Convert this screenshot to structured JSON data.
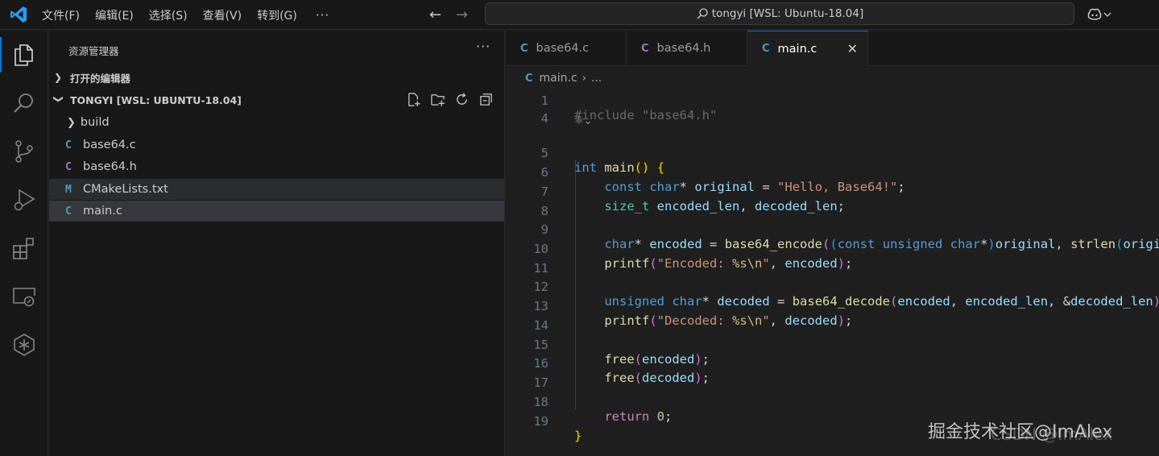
{
  "window": {
    "menu": [
      "文件(F)",
      "编辑(E)",
      "选择(S)",
      "查看(V)",
      "转到(G)"
    ],
    "menu_more": "···",
    "search_text": "tongyi [WSL: Ubuntu-18.04]"
  },
  "activity_bar": [
    "explorer-icon",
    "search-icon",
    "source-control-icon",
    "run-debug-icon",
    "extensions-icon",
    "remote-explorer-icon",
    "tongyi-icon"
  ],
  "sidebar": {
    "title": "资源管理器",
    "more": "···",
    "open_editors": "打开的编辑器",
    "workspace": "TONGYI [WSL: UBUNTU-18.04]",
    "tree": [
      {
        "name": "build",
        "kind": "folder"
      },
      {
        "name": "base64.c",
        "kind": "c",
        "icon": "C"
      },
      {
        "name": "base64.h",
        "kind": "h",
        "icon": "C"
      },
      {
        "name": "CMakeLists.txt",
        "kind": "cmake",
        "icon": "M"
      },
      {
        "name": "main.c",
        "kind": "c",
        "icon": "C"
      }
    ]
  },
  "editor": {
    "tabs": [
      {
        "label": "base64.c",
        "icon": "C",
        "active": false
      },
      {
        "label": "base64.h",
        "icon": "C",
        "active": false
      },
      {
        "label": "main.c",
        "icon": "C",
        "active": true
      }
    ],
    "close_glyph": "✕",
    "breadcrumb": {
      "file": "main.c",
      "sep": "›",
      "rest": "..."
    },
    "partial_line": "#include \"base64.h\"",
    "line_numbers": [
      "1",
      "4",
      "5",
      "6",
      "7",
      "8",
      "9",
      "10",
      "11",
      "12",
      "13",
      "14",
      "15",
      "16",
      "17",
      "18",
      "19"
    ]
  },
  "watermark": "掘金技术社区@ImAlex",
  "watermark_faint": "CSDN @ImAlex",
  "colors": {
    "accent": "#0078d4",
    "c_icon": "#519aba",
    "h_icon": "#a074c4"
  }
}
